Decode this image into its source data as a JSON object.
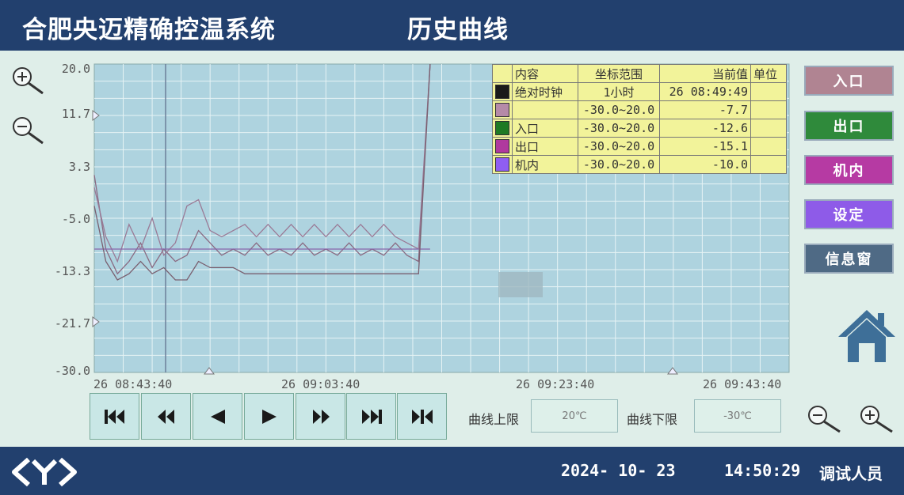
{
  "header": {
    "app_title": "合肥央迈精确控温系统",
    "page_title": "历史曲线"
  },
  "chart_data": {
    "type": "line",
    "ylim": [
      -30.0,
      20.0
    ],
    "y_ticks": [
      "20.0",
      "11.7",
      "3.3",
      "-5.0",
      "-13.3",
      "-21.7",
      "-30.0"
    ],
    "x_ticks": [
      "26 08:43:40",
      "26 09:03:40",
      "26 09:23:40",
      "26 09:43:40"
    ],
    "x_minutes": [
      0,
      20,
      40,
      60
    ],
    "series": [
      {
        "name": "入口",
        "color": "#8a6a82",
        "x": [
          0,
          1,
          2,
          3,
          4,
          5,
          6,
          7,
          8,
          9,
          10,
          11,
          12,
          13,
          14,
          15,
          16,
          17,
          18,
          19,
          20,
          21,
          22,
          23,
          24,
          25,
          26,
          27,
          28,
          29
        ],
        "y": [
          2,
          -10,
          -14,
          -12,
          -9,
          -13,
          -10,
          -12,
          -11,
          -7,
          -9,
          -11,
          -10,
          -11,
          -9,
          -11,
          -10,
          -11,
          -9,
          -11,
          -10,
          -11,
          -9,
          -11,
          -10,
          -11,
          -9,
          -11,
          -12,
          20
        ]
      },
      {
        "name": "出口",
        "color": "#9a7a96",
        "x": [
          0,
          1,
          2,
          3,
          4,
          5,
          6,
          7,
          8,
          9,
          10,
          11,
          12,
          13,
          14,
          15,
          16,
          17,
          18,
          19,
          20,
          21,
          22,
          23,
          24,
          25,
          26,
          27,
          28,
          29
        ],
        "y": [
          0,
          -8,
          -12,
          -6,
          -10,
          -5,
          -11,
          -9,
          -3,
          -2,
          -7,
          -8,
          -7,
          -6,
          -8,
          -6,
          -8,
          -6,
          -8,
          -6,
          -8,
          -6,
          -8,
          -6,
          -8,
          -6,
          -8,
          -9,
          -10,
          20
        ]
      },
      {
        "name": "机内",
        "color": "#8866aa",
        "x": [
          0,
          29
        ],
        "y": [
          -10.0,
          -10.0
        ]
      },
      {
        "name": "",
        "color": "#7a6070",
        "x": [
          0,
          1,
          2,
          3,
          4,
          5,
          6,
          7,
          8,
          9,
          10,
          11,
          12,
          13,
          14,
          15,
          16,
          17,
          18,
          19,
          20,
          21,
          22,
          23,
          24,
          25,
          26,
          27,
          28,
          29
        ],
        "y": [
          -3,
          -12,
          -15,
          -14,
          -12,
          -14,
          -13,
          -15,
          -15,
          -12,
          -13,
          -13,
          -13,
          -14,
          -14,
          -14,
          -14,
          -14,
          -14,
          -14,
          -14,
          -14,
          -14,
          -14,
          -14,
          -14,
          -14,
          -14,
          -14,
          20
        ]
      }
    ]
  },
  "legend": {
    "headers": [
      "内容",
      "坐标范围",
      "当前值",
      "单位"
    ],
    "rows": [
      {
        "color": "#1a1a1a",
        "name": "绝对时钟",
        "range": "1小时",
        "value": "26 08:49:49",
        "unit": ""
      },
      {
        "color": "#b58aa8",
        "name": "",
        "range": "-30.0~20.0",
        "value": "-7.7",
        "unit": ""
      },
      {
        "color": "#1f7a24",
        "name": "入口",
        "range": "-30.0~20.0",
        "value": "-12.6",
        "unit": ""
      },
      {
        "color": "#b0399e",
        "name": "出口",
        "range": "-30.0~20.0",
        "value": "-15.1",
        "unit": ""
      },
      {
        "color": "#8f5ef2",
        "name": "机内",
        "range": "-30.0~20.0",
        "value": "-10.0",
        "unit": ""
      }
    ]
  },
  "side_buttons": [
    {
      "label": "入口",
      "color": "#b08492"
    },
    {
      "label": "出口",
      "color": "#2f8a3b"
    },
    {
      "label": "机内",
      "color": "#b63aa3"
    },
    {
      "label": "设定",
      "color": "#8e5be8"
    },
    {
      "label": "信息窗",
      "color": "#4f6a85"
    }
  ],
  "limits": {
    "upper_label": "曲线上限",
    "upper_value": "20℃",
    "lower_label": "曲线下限",
    "lower_value": "-30℃"
  },
  "footer": {
    "date": "2024- 10- 23",
    "time": "14:50:29",
    "user": "调试人员"
  }
}
